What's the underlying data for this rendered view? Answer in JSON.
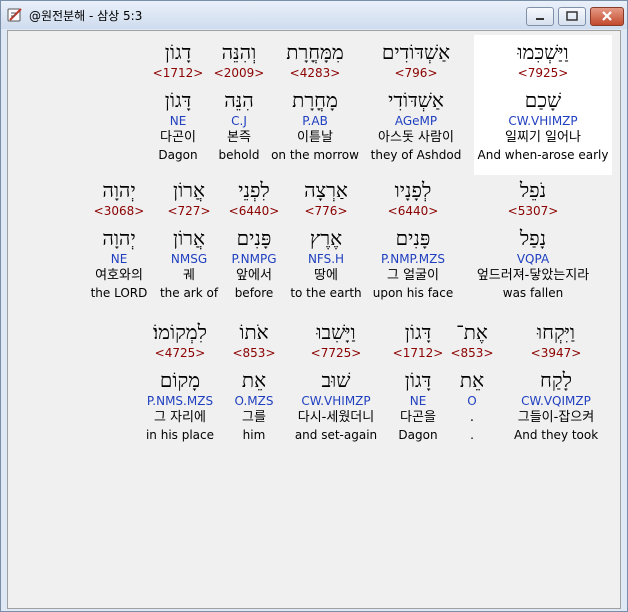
{
  "window": {
    "title": "@원전분해 - 삼상 5:3",
    "min_icon": "minimize-icon",
    "max_icon": "maximize-icon",
    "close_icon": "close-icon"
  },
  "rows": [
    {
      "words": [
        {
          "heb": "וַיַּשְׁכִּמוּ",
          "num": "<7925>",
          "lemma": "שָׁכַם",
          "morph": "CW.VHIMZP",
          "kor": "일찌기 일어나",
          "eng": "And when-arose early",
          "highlight": true
        },
        {
          "heb": "אַשְׁדּוֹדִים",
          "num": "<796>",
          "lemma": "אַשְׁדּוֹדִי",
          "morph": "AGeMP",
          "kor": "아스돗 사람이",
          "eng": "they of Ashdod"
        },
        {
          "heb": "מִמָּחֳרָת",
          "num": "<4283>",
          "lemma": "מָחֳרָת",
          "morph": "P.AB",
          "kor": "이튿날",
          "eng": "on the morrow"
        },
        {
          "heb": "וְהִנֵּה",
          "num": "<2009>",
          "lemma": "הִנֵּה",
          "morph": "C.J",
          "kor": "본즉",
          "eng": "behold"
        },
        {
          "heb": "דָגוֹן",
          "num": "<1712>",
          "lemma": "דָּגוֹן",
          "morph": "NE",
          "kor": "다곤이",
          "eng": "Dagon"
        }
      ]
    },
    {
      "words": [
        {
          "heb": "נֹפֵל",
          "num": "<5307>",
          "lemma": "נָפַל",
          "morph": "VQPA",
          "kor": "엎드러져-닿았는지라",
          "eng": "was fallen"
        },
        {
          "heb": "לְפָנָיו",
          "num": "<6440>",
          "lemma": "פָּנִים",
          "morph": "P.NMP.MZS",
          "kor": "그 얼굴이",
          "eng": "upon his face"
        },
        {
          "heb": "אַרְצָה",
          "num": "<776>",
          "lemma": "אֶרֶץ",
          "morph": "NFS.H",
          "kor": "땅에",
          "eng": "to the earth"
        },
        {
          "heb": "לִפְנֵי",
          "num": "<6440>",
          "lemma": "פָּנִים",
          "morph": "P.NMPG",
          "kor": "앞에서",
          "eng": "before"
        },
        {
          "heb": "אֲרוֹן",
          "num": "<727>",
          "lemma": "אֲרוֹן",
          "morph": "NMSG",
          "kor": "궤",
          "eng": "the ark of"
        },
        {
          "heb": "יְהוָה",
          "num": "<3068>",
          "lemma": "יְהוָה",
          "morph": "NE",
          "kor": "여호와의",
          "eng": "the LORD"
        }
      ]
    },
    {
      "words": [
        {
          "heb": "וַיִּקְחוּ",
          "num": "<3947>",
          "lemma": "לָקַח",
          "morph": "CW.VQIMZP",
          "kor": "그들이-잡으켜",
          "eng": "And they took"
        },
        {
          "heb": "אֶת־",
          "num": "<853>",
          "lemma": "אֵת",
          "morph": "O",
          "kor": ".",
          "eng": "."
        },
        {
          "heb": "דָּגוֹן",
          "num": "<1712>",
          "lemma": "דָּגוֹן",
          "morph": "NE",
          "kor": "다곤을",
          "eng": "Dagon"
        },
        {
          "heb": "וַיָּשִׁבוּ",
          "num": "<7725>",
          "lemma": "שׁוּב",
          "morph": "CW.VHIMZP",
          "kor": "다시-세웠더니",
          "eng": "and set-again"
        },
        {
          "heb": "אֹתוֹ",
          "num": "<853>",
          "lemma": "אֵת",
          "morph": "O.MZS",
          "kor": "그를",
          "eng": "him"
        },
        {
          "heb": "לִמְקוֹמוֹ׃",
          "num": "<4725>",
          "lemma": "מָקוֹם",
          "morph": "P.NMS.MZS",
          "kor": "그 자리에",
          "eng": "in his place"
        }
      ]
    }
  ]
}
